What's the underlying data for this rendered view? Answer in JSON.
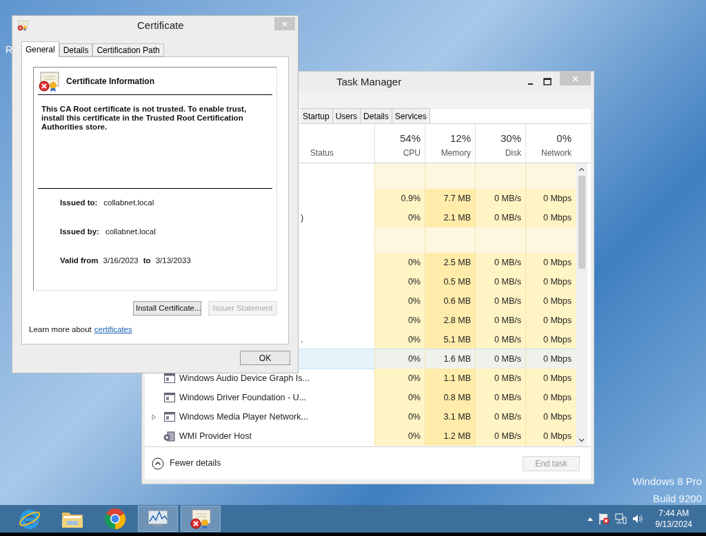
{
  "desktop": {
    "icon_label": "R",
    "watermark": [
      "Windows 8 Pro",
      "Build 9200"
    ]
  },
  "task_manager": {
    "title": "Task Manager",
    "tabs": [
      {
        "label": "Startup",
        "selected": false
      },
      {
        "label": "Users",
        "selected": false
      },
      {
        "label": "Details",
        "selected": false
      },
      {
        "label": "Services",
        "selected": false
      }
    ],
    "columns": [
      {
        "label": "Status"
      },
      {
        "percent": "54%",
        "label": "CPU"
      },
      {
        "percent": "12%",
        "label": "Memory"
      },
      {
        "percent": "30%",
        "label": "Disk"
      },
      {
        "percent": "0%",
        "label": "Network"
      }
    ],
    "rows": [
      {
        "kind": "group",
        "selected": false
      },
      {
        "kind": "process",
        "selected": false,
        "cells": [
          "0.9%",
          "7.7 MB",
          "0 MB/s",
          "0 Mbps"
        ]
      },
      {
        "kind": "process",
        "name": ")",
        "selected": false,
        "cells": [
          "0%",
          "2.1 MB",
          "0 MB/s",
          "0 Mbps"
        ]
      },
      {
        "kind": "group",
        "selected": false
      },
      {
        "kind": "process",
        "selected": false,
        "cells": [
          "0%",
          "2.5 MB",
          "0 MB/s",
          "0 Mbps"
        ]
      },
      {
        "kind": "process",
        "selected": false,
        "cells": [
          "0%",
          "0.5 MB",
          "0 MB/s",
          "0 Mbps"
        ]
      },
      {
        "kind": "process",
        "selected": false,
        "cells": [
          "0%",
          "0.6 MB",
          "0 MB/s",
          "0 Mbps"
        ]
      },
      {
        "kind": "process",
        "selected": false,
        "cells": [
          "0%",
          "2.8 MB",
          "0 MB/s",
          "0 Mbps"
        ]
      },
      {
        "kind": "process",
        "name": ".",
        "selected": false,
        "cells": [
          "0%",
          "5.1 MB",
          "0 MB/s",
          "0 Mbps"
        ]
      },
      {
        "kind": "process",
        "selected": true,
        "cells": [
          "0%",
          "1.6 MB",
          "0 MB/s",
          "0 Mbps"
        ]
      },
      {
        "kind": "app",
        "name": "Windows Audio Device Graph Is...",
        "expandable": false,
        "selected": false,
        "cells": [
          "0%",
          "1.1 MB",
          "0 MB/s",
          "0 Mbps"
        ]
      },
      {
        "kind": "app",
        "name": "Windows Driver Foundation - U...",
        "expandable": false,
        "selected": false,
        "cells": [
          "0%",
          "0.8 MB",
          "0 MB/s",
          "0 Mbps"
        ]
      },
      {
        "kind": "app",
        "name": "Windows Media Player Network...",
        "expandable": true,
        "selected": false,
        "cells": [
          "0%",
          "3.1 MB",
          "0 MB/s",
          "0 Mbps"
        ]
      },
      {
        "kind": "service",
        "name": "WMI Provider Host",
        "expandable": false,
        "selected": false,
        "cells": [
          "0%",
          "1.2 MB",
          "0 MB/s",
          "0 Mbps"
        ]
      }
    ],
    "fewer_details": "Fewer details",
    "end_task": {
      "label": "End task",
      "disabled": true
    }
  },
  "certificate": {
    "title": "Certificate",
    "tabs": [
      {
        "label": "General",
        "selected": true
      },
      {
        "label": "Details",
        "selected": false
      },
      {
        "label": "Certification Path",
        "selected": false
      }
    ],
    "heading": "Certificate Information",
    "message": "This CA Root certificate is not trusted. To enable trust, install this certificate in the Trusted Root Certification Authorities store.",
    "issued_to": {
      "label": "Issued to:",
      "value": "collabnet.local"
    },
    "issued_by": {
      "label": "Issued by:",
      "value": "collabnet.local"
    },
    "valid": {
      "label": "Valid from",
      "from": "3/16/2023",
      "to_label": "to",
      "to": "3/13/2033"
    },
    "buttons": [
      {
        "label": "Install Certificate...",
        "disabled": false
      },
      {
        "label": "Issuer Statement",
        "disabled": true
      }
    ],
    "learn_more": "Learn more about",
    "link": "certificates",
    "ok": "OK"
  },
  "taskbar": {
    "apps": [
      {
        "kind": "ie",
        "active": false
      },
      {
        "kind": "folder",
        "active": false
      },
      {
        "kind": "chrome",
        "active": false
      },
      {
        "kind": "taskmgr",
        "active": true
      },
      {
        "kind": "cert",
        "active": true
      }
    ],
    "time": "7:44 AM",
    "date": "9/13/2024"
  }
}
